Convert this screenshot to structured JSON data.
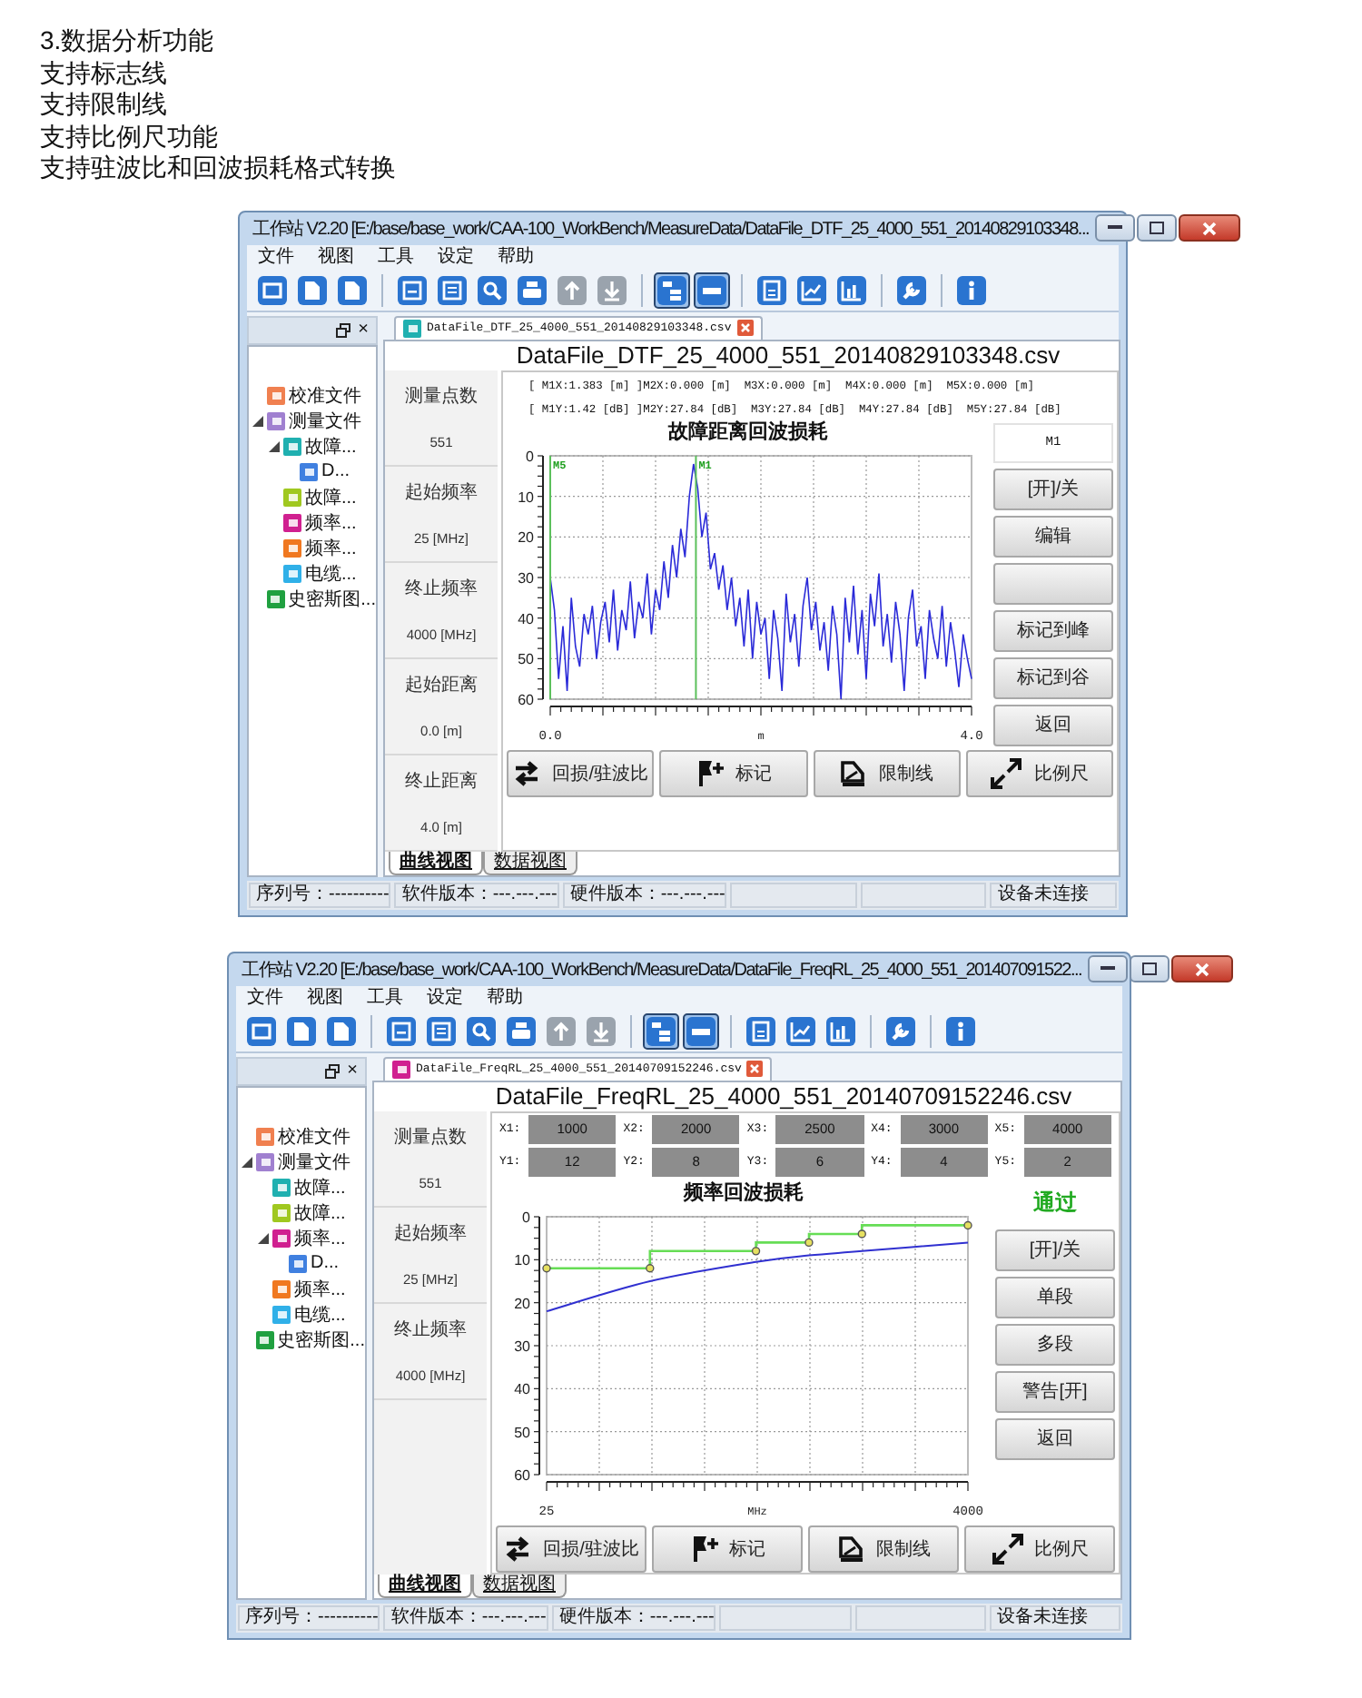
{
  "intro": [
    "3.数据分析功能",
    "支持标志线",
    "支持限制线",
    "支持比例尺功能",
    "支持驻波比和回波损耗格式转换"
  ],
  "windows": [
    {
      "title": "工作站 V2.20 [E:/base/base_work/CAA-100_WorkBench/MeasureData/DataFile_DTF_25_4000_551_20140829103348...",
      "menu": [
        "文件",
        "视图",
        "工具",
        "设定",
        "帮助"
      ],
      "toolbar": [
        [
          {
            "kind": "window",
            "pressed": false,
            "disabled": false
          },
          {
            "kind": "document",
            "pressed": false,
            "disabled": false
          },
          {
            "kind": "document",
            "pressed": false,
            "disabled": false
          }
        ],
        [
          {
            "kind": "save",
            "pressed": false,
            "disabled": false
          },
          {
            "kind": "save-list",
            "pressed": false,
            "disabled": false
          },
          {
            "kind": "search",
            "pressed": false,
            "disabled": false
          },
          {
            "kind": "print",
            "pressed": false,
            "disabled": false
          },
          {
            "kind": "upload",
            "pressed": false,
            "disabled": true
          },
          {
            "kind": "download",
            "pressed": false,
            "disabled": true
          }
        ],
        [
          {
            "kind": "tree",
            "pressed": true,
            "disabled": false
          },
          {
            "kind": "panel",
            "pressed": true,
            "disabled": false
          }
        ],
        [
          {
            "kind": "calculator",
            "pressed": false,
            "disabled": false
          },
          {
            "kind": "line-chart",
            "pressed": false,
            "disabled": false
          },
          {
            "kind": "bar-chart",
            "pressed": false,
            "disabled": false
          }
        ],
        [
          {
            "kind": "wrench",
            "pressed": false,
            "disabled": false
          }
        ],
        [
          {
            "kind": "info",
            "pressed": false,
            "disabled": false
          }
        ]
      ],
      "panel_close": "×",
      "tree": [
        {
          "label": "校准文件",
          "color": "#f08050",
          "expanded": false
        },
        {
          "label": "测量文件",
          "color": "#a080d0",
          "expanded": true,
          "children": [
            {
              "label": "故障...",
              "color": "#20b0b0",
              "expanded": true,
              "children": [
                {
                  "label": "D...",
                  "color": "#4080e0",
                  "expanded": false
                }
              ]
            },
            {
              "label": "故障...",
              "color": "#a0c820",
              "expanded": false
            },
            {
              "label": "频率...",
              "color": "#d02090",
              "expanded": false
            },
            {
              "label": "频率...",
              "color": "#f07820",
              "expanded": false
            },
            {
              "label": "电缆...",
              "color": "#30b0e8",
              "expanded": false
            }
          ]
        },
        {
          "label": "史密斯图...",
          "color": "#20a040",
          "expanded": false
        }
      ],
      "doc_tab": {
        "label": "DataFile_DTF_25_4000_551_20140829103348.csv",
        "color": "#20b0b0"
      },
      "file_title": "DataFile_DTF_25_4000_551_20140829103348.csv",
      "info": [
        {
          "label": "测量点数",
          "value": "551"
        },
        {
          "label": "起始频率",
          "value": "25 [MHz]"
        },
        {
          "label": "终止频率",
          "value": "4000 [MHz]"
        },
        {
          "label": "起始距离",
          "value": "0.0 [m]"
        },
        {
          "label": "终止距离",
          "value": "4.0 [m]"
        }
      ],
      "readouts": [
        "[ M1X:1.383 [m] ]M2X:0.000 [m]  M3X:0.000 [m]  M4X:0.000 [m]  M5X:0.000 [m]",
        "[ M1Y:1.42 [dB] ]M2Y:27.84 [dB]  M3Y:27.84 [dB]  M4Y:27.84 [dB]  M5Y:27.84 [dB]"
      ],
      "chart_data": {
        "type": "line",
        "title": "故障距离回波损耗",
        "xlabel": "m",
        "xlim": [
          0,
          4
        ],
        "ylim": [
          60,
          0
        ],
        "yticks": [
          0,
          10,
          20,
          30,
          40,
          50,
          60
        ],
        "xticks": [
          {
            "value": 0,
            "label": "0.0"
          },
          {
            "value": 4,
            "label": "4.0"
          }
        ],
        "x": [
          0,
          0.04,
          0.08,
          0.12,
          0.16,
          0.2,
          0.24,
          0.28,
          0.32,
          0.36,
          0.4,
          0.44,
          0.48,
          0.52,
          0.56,
          0.6,
          0.64,
          0.68,
          0.72,
          0.76,
          0.8,
          0.84,
          0.88,
          0.92,
          0.96,
          1,
          1.04,
          1.08,
          1.12,
          1.16,
          1.2,
          1.24,
          1.28,
          1.32,
          1.36,
          1.4,
          1.44,
          1.48,
          1.52,
          1.56,
          1.6,
          1.64,
          1.68,
          1.72,
          1.76,
          1.8,
          1.84,
          1.88,
          1.92,
          1.96,
          2,
          2.04,
          2.08,
          2.12,
          2.16,
          2.2,
          2.24,
          2.28,
          2.32,
          2.36,
          2.4,
          2.44,
          2.48,
          2.52,
          2.56,
          2.6,
          2.64,
          2.68,
          2.72,
          2.76,
          2.8,
          2.84,
          2.88,
          2.92,
          2.96,
          3,
          3.04,
          3.08,
          3.12,
          3.16,
          3.2,
          3.24,
          3.28,
          3.32,
          3.36,
          3.4,
          3.44,
          3.48,
          3.52,
          3.56,
          3.6,
          3.64,
          3.68,
          3.72,
          3.76,
          3.8,
          3.84,
          3.88,
          3.92,
          3.96,
          4
        ],
        "grid": true,
        "series": [
          {
            "color": "#2a2ad8",
            "values": [
              30,
              38,
              55,
              42,
              58,
              35,
              47,
              52,
              39,
              44,
              37,
              50,
              41,
              36,
              46,
              33,
              48,
              38,
              43,
              31,
              45,
              36,
              40,
              29,
              44,
              33,
              38,
              26,
              35,
              22,
              30,
              18,
              25,
              10,
              2,
              8,
              20,
              14,
              28,
              24,
              33,
              27,
              38,
              30,
              42,
              35,
              47,
              33,
              50,
              36,
              44,
              40,
              55,
              38,
              45,
              58,
              34,
              46,
              39,
              52,
              37,
              30,
              43,
              36,
              48,
              41,
              53,
              37,
              44,
              60,
              35,
              46,
              32,
              49,
              38,
              55,
              34,
              42,
              29,
              47,
              39,
              51,
              36,
              44,
              58,
              40,
              33,
              47,
              42,
              55,
              38,
              45,
              50,
              37,
              52,
              41,
              48,
              57,
              44,
              50,
              55
            ]
          }
        ],
        "ref_lines": [
          {
            "axis": "x",
            "value": 0,
            "label": "M5",
            "color": "#5cc05c"
          },
          {
            "axis": "x",
            "value": 1.383,
            "label": "M1",
            "color": "#5cc05c"
          }
        ]
      },
      "side_header": {
        "kind": "marker",
        "text": "M1"
      },
      "side_buttons": [
        {
          "kind": "text",
          "label": "[开]/关"
        },
        {
          "kind": "text",
          "label": "编辑"
        },
        {
          "kind": "blank"
        },
        {
          "kind": "text",
          "label": "标记到峰"
        },
        {
          "kind": "text",
          "label": "标记到谷"
        },
        {
          "kind": "text",
          "label": "返回"
        }
      ],
      "bottom_buttons": [
        {
          "kind": "swap",
          "label": "回损/驻波比"
        },
        {
          "kind": "flag",
          "label": "标记"
        },
        {
          "kind": "limit",
          "label": "限制线"
        },
        {
          "kind": "scale",
          "label": "比例尺"
        }
      ],
      "view_tabs": [
        {
          "label": "曲线视图",
          "selected": true
        },
        {
          "label": "数据视图",
          "selected": false
        }
      ],
      "status": [
        {
          "kind": "text",
          "text": "序列号：----------"
        },
        {
          "kind": "text",
          "text": "软件版本：---.---.---"
        },
        {
          "kind": "text",
          "text": "硬件版本：---.---.---"
        },
        {
          "kind": "blank"
        },
        {
          "kind": "blank"
        },
        {
          "kind": "text",
          "text": "设备未连接"
        }
      ]
    },
    {
      "title": "工作站 V2.20 [E:/base/base_work/CAA-100_WorkBench/MeasureData/DataFile_FreqRL_25_4000_551_201407091522...",
      "menu": [
        "文件",
        "视图",
        "工具",
        "设定",
        "帮助"
      ],
      "toolbar": [
        [
          {
            "kind": "window",
            "pressed": false,
            "disabled": false
          },
          {
            "kind": "document",
            "pressed": false,
            "disabled": false
          },
          {
            "kind": "document",
            "pressed": false,
            "disabled": false
          }
        ],
        [
          {
            "kind": "save",
            "pressed": false,
            "disabled": false
          },
          {
            "kind": "save-list",
            "pressed": false,
            "disabled": false
          },
          {
            "kind": "search",
            "pressed": false,
            "disabled": false
          },
          {
            "kind": "print",
            "pressed": false,
            "disabled": false
          },
          {
            "kind": "upload",
            "pressed": false,
            "disabled": true
          },
          {
            "kind": "download",
            "pressed": false,
            "disabled": true
          }
        ],
        [
          {
            "kind": "tree",
            "pressed": true,
            "disabled": false
          },
          {
            "kind": "panel",
            "pressed": true,
            "disabled": false
          }
        ],
        [
          {
            "kind": "calculator",
            "pressed": false,
            "disabled": false
          },
          {
            "kind": "line-chart",
            "pressed": false,
            "disabled": false
          },
          {
            "kind": "bar-chart",
            "pressed": false,
            "disabled": false
          }
        ],
        [
          {
            "kind": "wrench",
            "pressed": false,
            "disabled": false
          }
        ],
        [
          {
            "kind": "info",
            "pressed": false,
            "disabled": false
          }
        ]
      ],
      "panel_close": "×",
      "tree": [
        {
          "label": "校准文件",
          "color": "#f08050",
          "expanded": false
        },
        {
          "label": "测量文件",
          "color": "#a080d0",
          "expanded": true,
          "children": [
            {
              "label": "故障...",
              "color": "#20b0b0",
              "expanded": false
            },
            {
              "label": "故障...",
              "color": "#a0c820",
              "expanded": false
            },
            {
              "label": "频率...",
              "color": "#d02090",
              "expanded": true,
              "children": [
                {
                  "label": "D...",
                  "color": "#4080e0",
                  "expanded": false
                }
              ]
            },
            {
              "label": "频率...",
              "color": "#f07820",
              "expanded": false
            },
            {
              "label": "电缆...",
              "color": "#30b0e8",
              "expanded": false
            }
          ]
        },
        {
          "label": "史密斯图...",
          "color": "#20a040",
          "expanded": false
        }
      ],
      "doc_tab": {
        "label": "DataFile_FreqRL_25_4000_551_20140709152246.csv",
        "color": "#d02090"
      },
      "file_title": "DataFile_FreqRL_25_4000_551_20140709152246.csv",
      "info": [
        {
          "label": "测量点数",
          "value": "551"
        },
        {
          "label": "起始频率",
          "value": "25 [MHz]"
        },
        {
          "label": "终止频率",
          "value": "4000 [MHz]"
        }
      ],
      "limit_table": [
        [
          {
            "label": "X1:",
            "value": "1000"
          },
          {
            "label": "X2:",
            "value": "2000"
          },
          {
            "label": "X3:",
            "value": "2500"
          },
          {
            "label": "X4:",
            "value": "3000"
          },
          {
            "label": "X5:",
            "value": "4000"
          }
        ],
        [
          {
            "label": "Y1:",
            "value": "12"
          },
          {
            "label": "Y2:",
            "value": "8"
          },
          {
            "label": "Y3:",
            "value": "6"
          },
          {
            "label": "Y4:",
            "value": "4"
          },
          {
            "label": "Y5:",
            "value": "2"
          }
        ]
      ],
      "chart_data": {
        "type": "line",
        "title": "频率回波损耗",
        "xlabel": "MHz",
        "x": [
          25,
          1000,
          1000,
          2000,
          2000,
          2500,
          2500,
          3000,
          3000,
          4000
        ],
        "xlim": [
          25,
          4000
        ],
        "ylim": [
          60,
          0
        ],
        "yticks": [
          0,
          10,
          20,
          30,
          40,
          50,
          60
        ],
        "xticks": [
          {
            "value": 25,
            "label": "25"
          },
          {
            "value": 4000,
            "label": "4000"
          }
        ],
        "grid": true,
        "series": [
          {
            "color": "#66dd55",
            "values": [
              12,
              12,
              8,
              8,
              6,
              6,
              4,
              4,
              2,
              2
            ]
          },
          {
            "color": "#3030d0",
            "values": [
              22,
              15,
              null,
              10.5,
              null,
              9,
              null,
              8,
              null,
              6
            ]
          }
        ]
      },
      "side_header": {
        "kind": "verdict",
        "text": "通过"
      },
      "side_buttons": [
        {
          "kind": "text",
          "label": "[开]/关"
        },
        {
          "kind": "text",
          "label": "单段"
        },
        {
          "kind": "text",
          "label": "多段"
        },
        {
          "kind": "text",
          "label": "警告[开]"
        },
        {
          "kind": "text",
          "label": "返回"
        }
      ],
      "bottom_buttons": [
        {
          "kind": "swap",
          "label": "回损/驻波比"
        },
        {
          "kind": "flag",
          "label": "标记"
        },
        {
          "kind": "limit",
          "label": "限制线"
        },
        {
          "kind": "scale",
          "label": "比例尺"
        }
      ],
      "view_tabs": [
        {
          "label": "曲线视图",
          "selected": true
        },
        {
          "label": "数据视图",
          "selected": false
        }
      ],
      "status": [
        {
          "kind": "text",
          "text": "序列号：----------"
        },
        {
          "kind": "text",
          "text": "软件版本：---.---.---"
        },
        {
          "kind": "text",
          "text": "硬件版本：---.---.---"
        },
        {
          "kind": "blank"
        },
        {
          "kind": "blank"
        },
        {
          "kind": "text",
          "text": "设备未连接"
        }
      ]
    }
  ]
}
